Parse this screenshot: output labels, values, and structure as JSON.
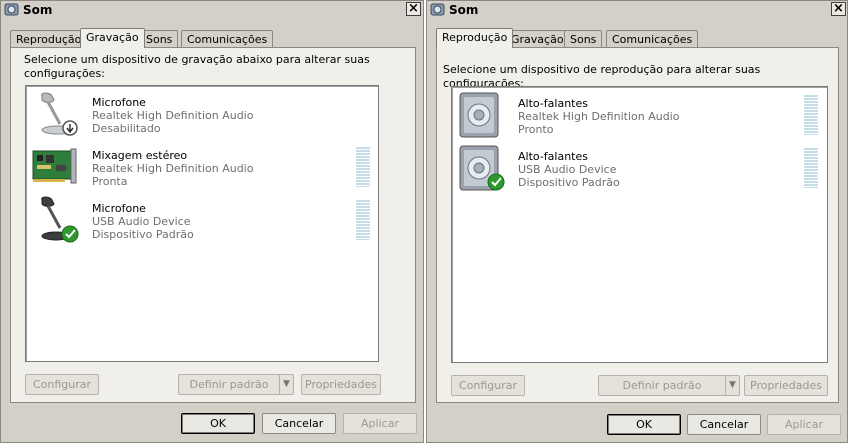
{
  "left": {
    "title": "Som",
    "tabs": [
      "Reprodução",
      "Gravação",
      "Sons",
      "Comunicações"
    ],
    "active_tab": "Gravação",
    "description_line1": "Selecione um dispositivo de gravação abaixo para alterar suas",
    "description_line2": "configurações:",
    "devices": [
      {
        "name": "Microfone",
        "driver": "Realtek High Definition Audio",
        "status": "Desabilitado",
        "icon": "microphone-disabled-icon",
        "level_meter": false
      },
      {
        "name": "Mixagem estéreo",
        "driver": "Realtek High Definition Audio",
        "status": "Pronta",
        "icon": "sound-card-icon",
        "level_meter": true
      },
      {
        "name": "Microfone",
        "driver": "USB Audio Device",
        "status": "Dispositivo Padrão",
        "icon": "microphone-default-icon",
        "level_meter": true
      }
    ],
    "buttons": {
      "configure": "Configurar",
      "set_default": "Definir padrão",
      "properties": "Propriedades"
    },
    "dialog_buttons": {
      "ok": "OK",
      "cancel": "Cancelar",
      "apply": "Aplicar"
    }
  },
  "right": {
    "title": "Som",
    "tabs": [
      "Reprodução",
      "Gravação",
      "Sons",
      "Comunicações"
    ],
    "active_tab": "Reprodução",
    "description_line1": "Selecione um dispositivo de reprodução para alterar suas configurações:",
    "devices": [
      {
        "name": "Alto-falantes",
        "driver": "Realtek High Definition Audio",
        "status": "Pronto",
        "icon": "speaker-icon",
        "level_meter": true
      },
      {
        "name": "Alto-falantes",
        "driver": "USB Audio Device",
        "status": "Dispositivo Padrão",
        "icon": "speaker-default-icon",
        "level_meter": true
      }
    ],
    "buttons": {
      "configure": "Configurar",
      "set_default": "Definir padrão",
      "properties": "Propriedades"
    },
    "dialog_buttons": {
      "ok": "OK",
      "cancel": "Cancelar",
      "apply": "Aplicar"
    }
  },
  "colors": {
    "window_bg": "#d4d0c8",
    "panel_bg": "#f0efe9",
    "meter": "#c5dde6",
    "default_check": "#2e9a2e",
    "disabled_text": "#9a9892"
  }
}
